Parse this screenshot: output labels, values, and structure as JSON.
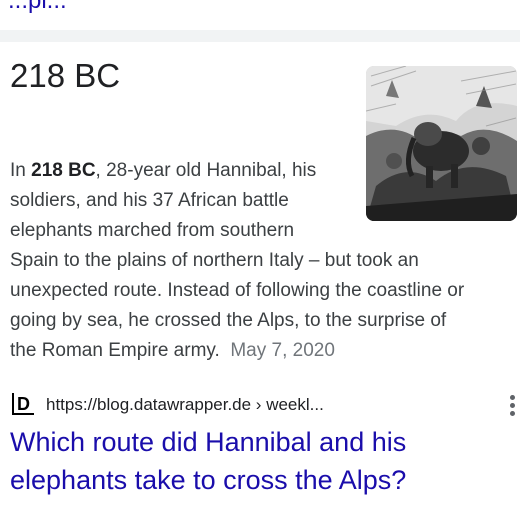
{
  "previous_result": {
    "link_fragment": "...pl..."
  },
  "answer": {
    "title": "218 BC",
    "image": {
      "subject": "engraving of Hannibal's army with elephants crossing the Alps"
    },
    "snippet": {
      "line1_prefix": "In ",
      "line1_bold": "218 BC",
      "line1_suffix": ", 28-year old Hannibal, his",
      "line2": "soldiers, and his 37 African battle",
      "line3": "elephants marched from southern",
      "line4": "Spain to the plains of northern Italy – but took an",
      "line5": "unexpected route. Instead of following the coastline or",
      "line6": "going by sea, he crossed the Alps, to the surprise of",
      "line7": "the Roman Empire army.",
      "date": "May 7, 2020"
    }
  },
  "source": {
    "favicon_letter": "D",
    "url": "https://blog.datawrapper.de › weekl...",
    "more_icon": "more-vert-icon"
  },
  "result": {
    "title_line1": "Which route did Hannibal and his",
    "title_line2": "elephants take to cross the Alps?"
  },
  "colors": {
    "link": "#1a0dab",
    "text": "#3c4043",
    "date": "#70757a",
    "divider": "#f1f3f4"
  }
}
